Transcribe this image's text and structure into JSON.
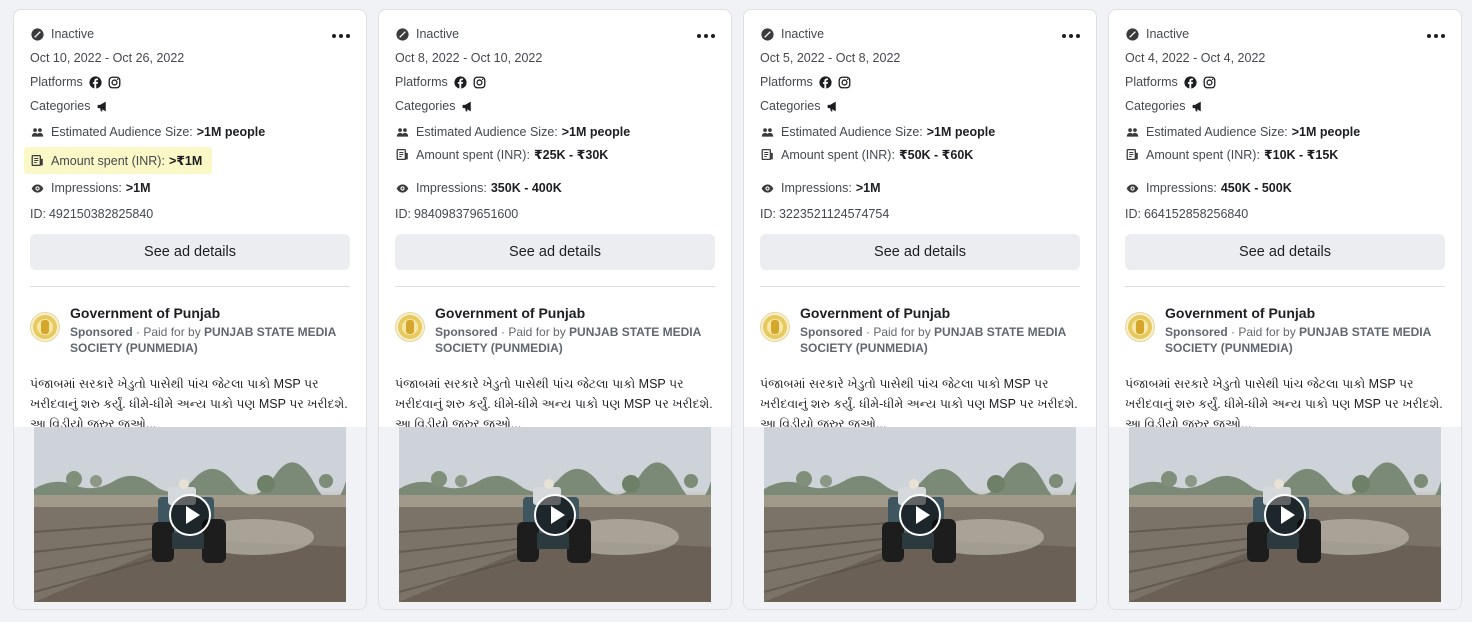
{
  "labels": {
    "platforms": "Platforms",
    "categories": "Categories",
    "audience": "Estimated Audience Size:",
    "amount": "Amount spent (INR):",
    "impressions": "Impressions:",
    "id_prefix": "ID: ",
    "see_details": "See ad details",
    "sponsored": "Sponsored",
    "paid_for_by": " · Paid for by "
  },
  "advertiser": {
    "name": "Government of Punjab",
    "funder": "PUNJAB STATE MEDIA SOCIETY (PUNMEDIA)",
    "ad_text": "પંજાબમાં સરકારે ખેડુતો પાસેથી પાંચ જેટલા પાકો MSP પર ખરીદવાનું શરુ કર્યું. ધીમે-ધીમે અન્ય પાકો પણ MSP પર ખરીદશે. આ વિડીયો જરુર જુઓ..."
  },
  "icons": {
    "status": "inactive-check-icon",
    "more": "more-options-icon",
    "facebook": "facebook-icon",
    "instagram": "instagram-icon",
    "category": "megaphone-icon",
    "audience": "people-icon",
    "amount": "money-icon",
    "impressions": "eye-icon",
    "play": "play-icon"
  },
  "colors": {
    "highlight": "#fbf8c7",
    "button_bg": "#ebedf0"
  },
  "cards": [
    {
      "status": "Inactive",
      "dates": "Oct 10, 2022 - Oct 26, 2022",
      "audience": ">1M people",
      "amount": ">₹1M",
      "amount_highlighted": true,
      "impressions": ">1M",
      "id": "492150382825840"
    },
    {
      "status": "Inactive",
      "dates": "Oct 8, 2022 - Oct 10, 2022",
      "audience": ">1M people",
      "amount": "₹25K - ₹30K",
      "amount_highlighted": false,
      "impressions": "350K - 400K",
      "id": "984098379651600"
    },
    {
      "status": "Inactive",
      "dates": "Oct 5, 2022 - Oct 8, 2022",
      "audience": ">1M people",
      "amount": "₹50K - ₹60K",
      "amount_highlighted": false,
      "impressions": ">1M",
      "id": "3223521124574754"
    },
    {
      "status": "Inactive",
      "dates": "Oct 4, 2022 - Oct 4, 2022",
      "audience": ">1M people",
      "amount": "₹10K - ₹15K",
      "amount_highlighted": false,
      "impressions": "450K - 500K",
      "id": "664152858256840"
    }
  ]
}
